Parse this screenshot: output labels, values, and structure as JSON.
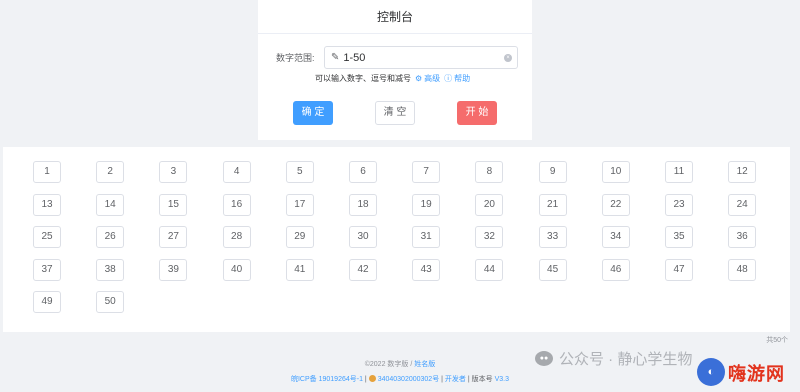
{
  "panel": {
    "title": "控制台",
    "range_label": "数字范围:",
    "range_value": "1-50",
    "hint_text": "可以输入数字、逗号和减号",
    "advanced_label": "高级",
    "help_label": "帮助",
    "ok_label": "确 定",
    "clear_label": "清 空",
    "start_label": "开 始"
  },
  "numbers": [
    "1",
    "2",
    "3",
    "4",
    "5",
    "6",
    "7",
    "8",
    "9",
    "10",
    "11",
    "12",
    "13",
    "14",
    "15",
    "16",
    "17",
    "18",
    "19",
    "20",
    "21",
    "22",
    "23",
    "24",
    "25",
    "26",
    "27",
    "28",
    "29",
    "30",
    "31",
    "32",
    "33",
    "34",
    "35",
    "36",
    "37",
    "38",
    "39",
    "40",
    "41",
    "42",
    "43",
    "44",
    "45",
    "46",
    "47",
    "48",
    "49",
    "50"
  ],
  "total_text": "共50个",
  "footer": {
    "copyright": "©2022 数字版 / ",
    "name_version_link": "姓名版",
    "icp": "皖ICP备 19019264号-1",
    "police": "34040302000302号",
    "developer": "开发者",
    "version_label": "版本号",
    "version": "V3.3",
    "sep": " | "
  },
  "watermark": {
    "text": "公众号 · 静心学生物"
  },
  "logo": {
    "text": "嗨游网"
  },
  "colors": {
    "primary": "#409eff",
    "danger": "#f56c6c"
  }
}
